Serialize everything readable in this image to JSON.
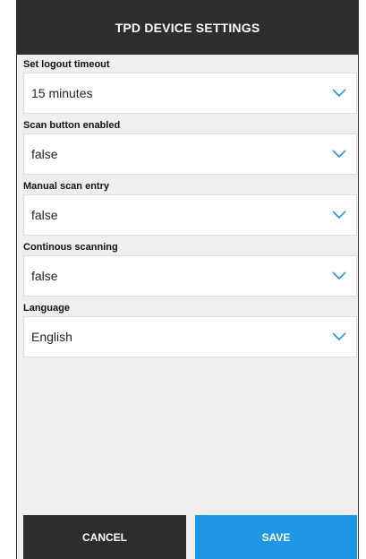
{
  "header": {
    "title": "TPD DEVICE SETTINGS"
  },
  "fields": [
    {
      "label": "Set logout timeout",
      "value": "15 minutes"
    },
    {
      "label": "Scan button enabled",
      "value": "false"
    },
    {
      "label": "Manual scan entry",
      "value": "false"
    },
    {
      "label": "Continous scanning",
      "value": "false"
    },
    {
      "label": "Language",
      "value": "English"
    }
  ],
  "buttons": {
    "cancel": "CANCEL",
    "save": "SAVE"
  },
  "colors": {
    "header_bg": "#2d2d2d",
    "accent": "#1e96e3",
    "panel_bg": "#efefef"
  },
  "icons": {
    "dropdown": "chevron-down-icon"
  }
}
